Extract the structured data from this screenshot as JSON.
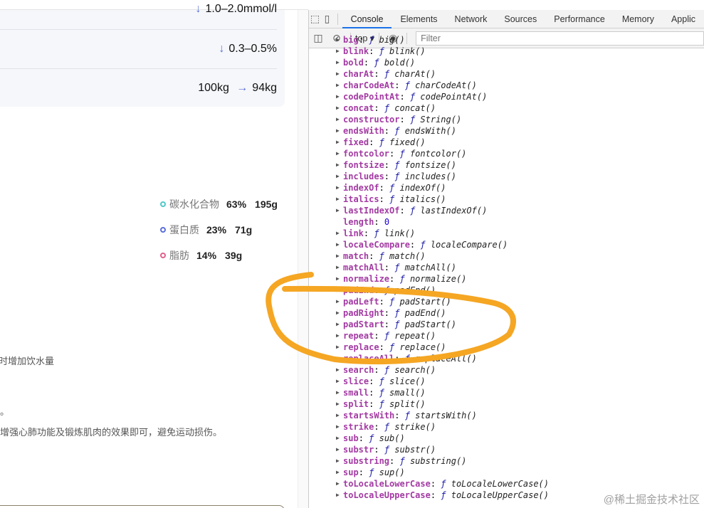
{
  "page": {
    "metrics": [
      {
        "value": "1.0–2.0mmol/l",
        "arrow": "↓"
      },
      {
        "value": "0.3–0.5%",
        "arrow": "↓"
      },
      {
        "from": "100kg",
        "arrow": "→",
        "to": "94kg"
      }
    ],
    "nutrients": [
      {
        "name": "碳水化合物",
        "percent": "63%",
        "grams": "195g",
        "color": "#4fc9c9"
      },
      {
        "name": "蛋白质",
        "percent": "23%",
        "grams": "71g",
        "color": "#5b6fd8"
      },
      {
        "name": "脂肪",
        "percent": "14%",
        "grams": "39g",
        "color": "#e0608a"
      }
    ],
    "texts": [
      "时增加饮水量",
      "。",
      "增强心肺功能及锻炼肌肉的效果即可，避免运动损伤。"
    ]
  },
  "devtools": {
    "tabs": [
      "Console",
      "Elements",
      "Network",
      "Sources",
      "Performance",
      "Memory",
      "Applic"
    ],
    "active_tab": "Console",
    "context": "top ▾",
    "filter_placeholder": "Filter",
    "items": [
      [
        "big",
        "big()"
      ],
      [
        "blink",
        "blink()"
      ],
      [
        "bold",
        "bold()"
      ],
      [
        "charAt",
        "charAt()"
      ],
      [
        "charCodeAt",
        "charCodeAt()"
      ],
      [
        "codePointAt",
        "codePointAt()"
      ],
      [
        "concat",
        "concat()"
      ],
      [
        "constructor",
        "String()"
      ],
      [
        "endsWith",
        "endsWith()"
      ],
      [
        "fixed",
        "fixed()"
      ],
      [
        "fontcolor",
        "fontcolor()"
      ],
      [
        "fontsize",
        "fontsize()"
      ],
      [
        "includes",
        "includes()"
      ],
      [
        "indexOf",
        "indexOf()"
      ],
      [
        "italics",
        "italics()"
      ],
      [
        "lastIndexOf",
        "lastIndexOf()"
      ],
      [
        "length",
        "0"
      ],
      [
        "link",
        "link()"
      ],
      [
        "localeCompare",
        "localeCompare()"
      ],
      [
        "match",
        "match()"
      ],
      [
        "matchAll",
        "matchAll()"
      ],
      [
        "normalize",
        "normalize()"
      ],
      [
        "padEnd",
        "padEnd()"
      ],
      [
        "padLeft",
        "padStart()"
      ],
      [
        "padRight",
        "padEnd()"
      ],
      [
        "padStart",
        "padStart()"
      ],
      [
        "repeat",
        "repeat()"
      ],
      [
        "replace",
        "replace()"
      ],
      [
        "replaceAll",
        "replaceAll()"
      ],
      [
        "search",
        "search()"
      ],
      [
        "slice",
        "slice()"
      ],
      [
        "small",
        "small()"
      ],
      [
        "split",
        "split()"
      ],
      [
        "startsWith",
        "startsWith()"
      ],
      [
        "strike",
        "strike()"
      ],
      [
        "sub",
        "sub()"
      ],
      [
        "substr",
        "substr()"
      ],
      [
        "substring",
        "substring()"
      ],
      [
        "sup",
        "sup()"
      ],
      [
        "toLocaleLowerCase",
        "toLocaleLowerCase()"
      ],
      [
        "toLocaleUpperCase",
        "toLocaleUpperCase()"
      ]
    ]
  },
  "watermark": "@稀土掘金技术社区",
  "annotation_color": "#f5a623"
}
